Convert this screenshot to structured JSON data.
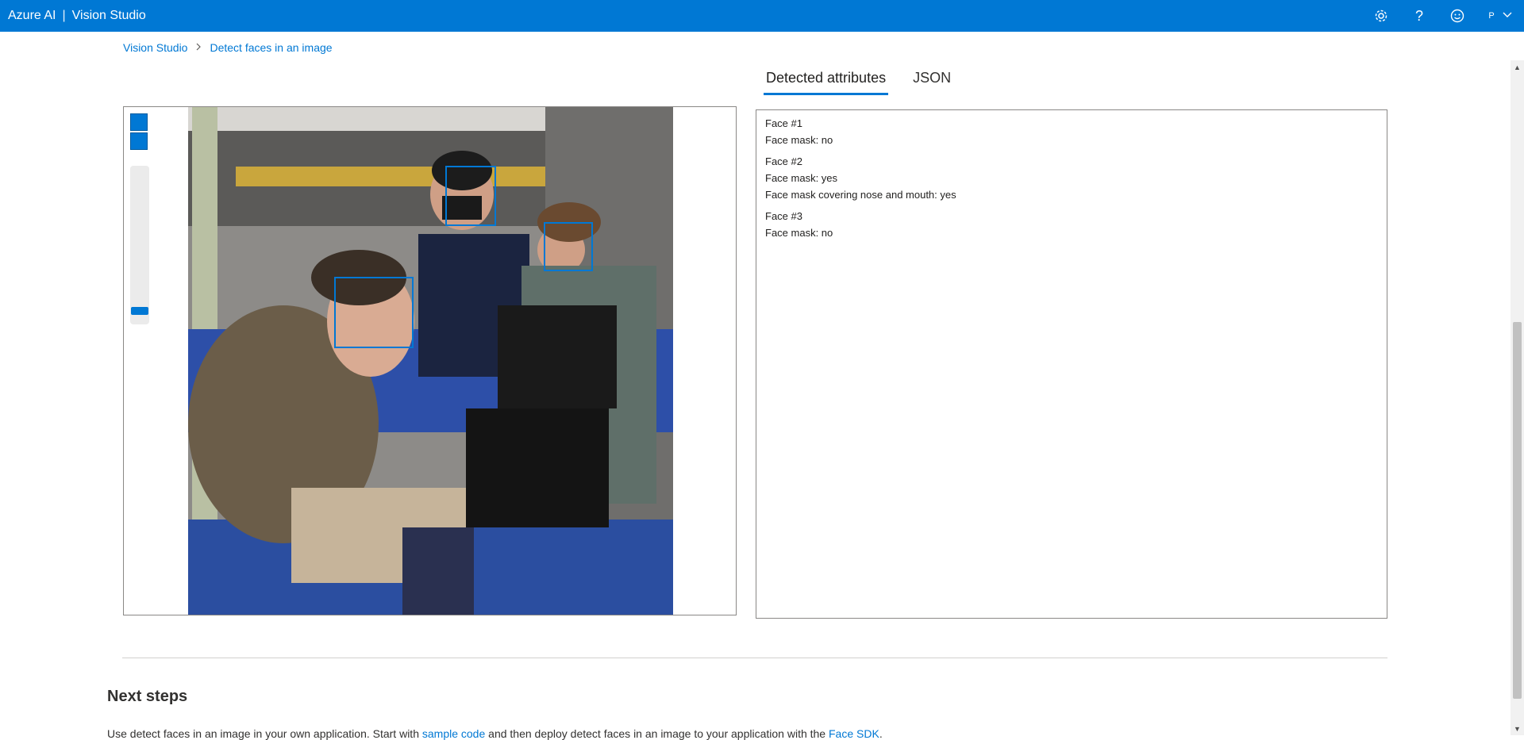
{
  "header": {
    "brand": "Azure AI",
    "separator": "|",
    "product": "Vision Studio",
    "avatar_initial": "P"
  },
  "breadcrumb": {
    "root": "Vision Studio",
    "current": "Detect faces in an image"
  },
  "tabs": [
    {
      "label": "Detected attributes",
      "active": true
    },
    {
      "label": "JSON",
      "active": false
    }
  ],
  "faces": [
    {
      "title": "Face #1",
      "lines": [
        "Face mask: no"
      ]
    },
    {
      "title": "Face #2",
      "lines": [
        "Face mask: yes",
        "Face mask covering nose and mouth: yes"
      ]
    },
    {
      "title": "Face #3",
      "lines": [
        "Face mask: no"
      ]
    }
  ],
  "next_steps": {
    "heading": "Next steps",
    "text_prefix": "Use detect faces in an image in your own application. Start with ",
    "link1": "sample code",
    "text_middle": " and then deploy detect faces in an image to your application with the ",
    "link2": "Face SDK",
    "text_suffix": "."
  },
  "colors": {
    "accent": "#0078d4",
    "face_box": "#0078d4"
  },
  "icons": [
    "settings-icon",
    "help-icon",
    "feedback-icon",
    "chevron-down-icon",
    "chevron-right-icon"
  ]
}
